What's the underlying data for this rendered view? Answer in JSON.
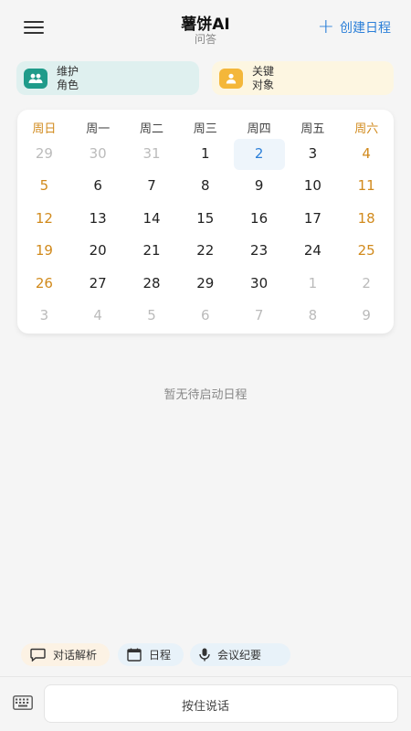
{
  "header": {
    "title": "薯饼AI",
    "subtitle": "问答",
    "create_label": "创建日程",
    "accent": "#2b7fd8"
  },
  "roles": [
    {
      "line1": "维护",
      "line2": "角色",
      "icon": "people-icon",
      "color": "#1f9b8a"
    },
    {
      "line1": "关键",
      "line2": "对象",
      "icon": "person-icon",
      "color": "#f4b73a"
    }
  ],
  "calendar": {
    "weekdays": [
      "周日",
      "周一",
      "周二",
      "周三",
      "周四",
      "周五",
      "周六"
    ],
    "weekend_color": "#d18a1c",
    "weeks": [
      [
        "29",
        "30",
        "31",
        "1",
        "2",
        "3",
        "4"
      ],
      [
        "5",
        "6",
        "7",
        "8",
        "9",
        "10",
        "11"
      ],
      [
        "12",
        "13",
        "14",
        "15",
        "16",
        "17",
        "18"
      ],
      [
        "19",
        "20",
        "21",
        "22",
        "23",
        "24",
        "25"
      ],
      [
        "26",
        "27",
        "28",
        "29",
        "30",
        "1",
        "2"
      ],
      [
        "3",
        "4",
        "5",
        "6",
        "7",
        "8",
        "9"
      ]
    ],
    "today": "2"
  },
  "empty_text": "暂无待启动日程",
  "quick_actions": [
    {
      "label": "对话解析",
      "icon": "chat-icon"
    },
    {
      "label": "日程",
      "icon": "calendar-icon"
    },
    {
      "label": "会议纪要",
      "icon": "mic-icon"
    }
  ],
  "bottom": {
    "talk_label": "按住说话",
    "keyboard_icon": "keyboard-icon"
  }
}
